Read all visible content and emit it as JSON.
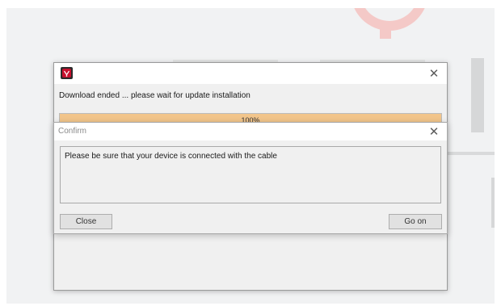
{
  "update_window": {
    "message": "Download ended ... please wait for update installation",
    "progress_label": "100%",
    "progress_value": 100,
    "close_icon": "close-icon",
    "app_icon": "app-logo-icon"
  },
  "confirm_dialog": {
    "title": "Confirm",
    "message": "Please be sure that your device is connected with the cable",
    "close_label": "Close",
    "go_on_label": "Go on",
    "close_icon": "close-icon"
  },
  "colors": {
    "progress_fill": "#f2c58b",
    "app_icon_red": "#c8102e"
  }
}
